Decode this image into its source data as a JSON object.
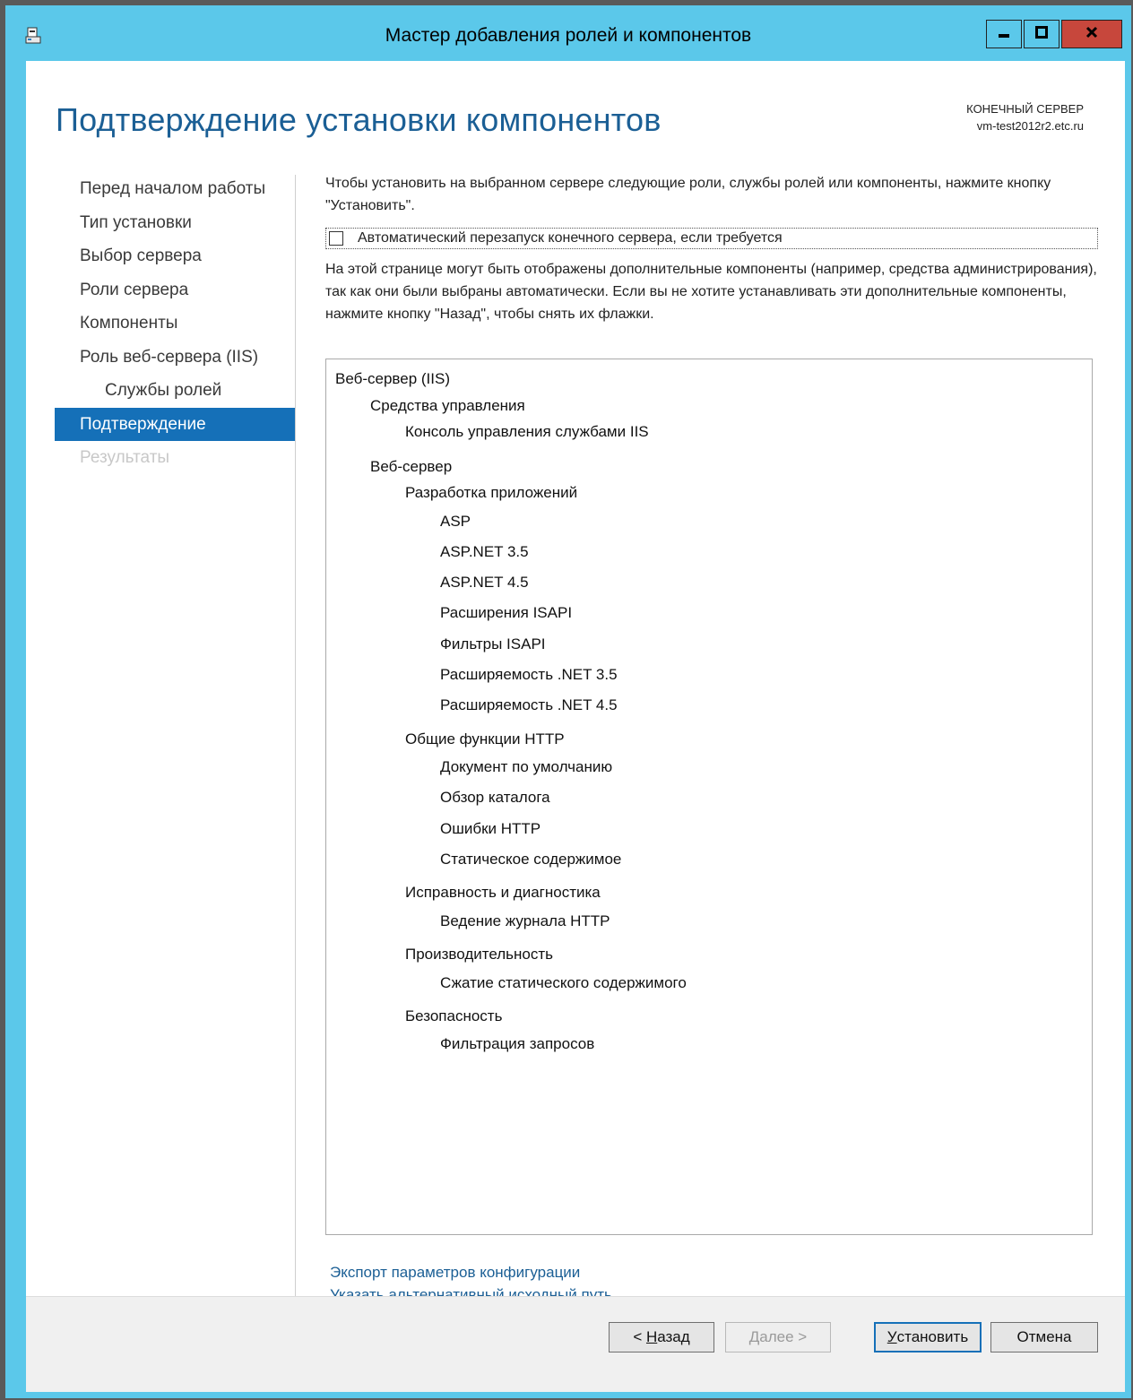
{
  "window": {
    "title": "Мастер добавления ролей и компонентов",
    "accent_color": "#5bc8ea",
    "close_color": "#c7473c",
    "icons": {
      "app": "server-manager-icon",
      "min": "minimize-icon",
      "max": "maximize-icon",
      "close": "close-icon"
    }
  },
  "header": {
    "title": "Подтверждение установки компонентов",
    "dest_label": "КОНЕЧНЫЙ СЕРВЕР",
    "dest_value": "vm-test2012r2.etc.ru"
  },
  "nav": {
    "active_color": "#1570b8",
    "items": [
      {
        "label": "Перед началом работы",
        "state": "normal"
      },
      {
        "label": "Тип установки",
        "state": "normal"
      },
      {
        "label": "Выбор сервера",
        "state": "normal"
      },
      {
        "label": "Роли сервера",
        "state": "normal"
      },
      {
        "label": "Компоненты",
        "state": "normal"
      },
      {
        "label": "Роль веб-сервера (IIS)",
        "state": "normal"
      },
      {
        "label": "Службы ролей",
        "state": "normal",
        "sub": true
      },
      {
        "label": "Подтверждение",
        "state": "active"
      },
      {
        "label": "Результаты",
        "state": "disabled"
      }
    ]
  },
  "content": {
    "intro": "Чтобы установить на выбранном сервере следующие роли, службы ролей или компоненты, нажмите кнопку \"Установить\".",
    "restart_label": "Автоматический перезапуск конечного сервера, если требуется",
    "restart_checked": false,
    "note": "На этой странице могут быть отображены дополнительные компоненты (например, средства администрирования), так как они были выбраны автоматически. Если вы не хотите устанавливать эти дополнительные компоненты, нажмите кнопку \"Назад\", чтобы снять их флажки."
  },
  "components": [
    {
      "text": "Веб-сервер (IIS)",
      "level": 0
    },
    {
      "text": "Средства управления",
      "level": 1
    },
    {
      "text": "Консоль управления службами IIS",
      "level": 2
    },
    {
      "text": "Веб-сервер",
      "level": 1
    },
    {
      "text": "Разработка приложений",
      "level": 2
    },
    {
      "text": "ASP",
      "level": 3
    },
    {
      "text": "ASP.NET 3.5",
      "level": 3
    },
    {
      "text": "ASP.NET 4.5",
      "level": 3
    },
    {
      "text": "Расширения ISAPI",
      "level": 3
    },
    {
      "text": "Фильтры ISAPI",
      "level": 3
    },
    {
      "text": "Расширяемость .NET 3.5",
      "level": 3
    },
    {
      "text": "Расширяемость .NET 4.5",
      "level": 3
    },
    {
      "text": "Общие функции HTTP",
      "level": 2
    },
    {
      "text": "Документ по умолчанию",
      "level": 3
    },
    {
      "text": "Обзор каталога",
      "level": 3
    },
    {
      "text": "Ошибки HTTP",
      "level": 3
    },
    {
      "text": "Статическое содержимое",
      "level": 3
    },
    {
      "text": "Исправность и диагностика",
      "level": 2
    },
    {
      "text": "Ведение журнала HTTP",
      "level": 3
    },
    {
      "text": "Производительность",
      "level": 2
    },
    {
      "text": "Сжатие статического содержимого",
      "level": 3
    },
    {
      "text": "Безопасность",
      "level": 2
    },
    {
      "text": "Фильтрация запросов",
      "level": 3
    }
  ],
  "links": {
    "export": "Экспорт параметров конфигурации",
    "alt_source": "Указать альтернативный исходный путь"
  },
  "buttons": {
    "back_prefix": "< ",
    "back_key": "Н",
    "back_rest": "азад",
    "next_key": "Д",
    "next_rest": "алее >",
    "install_key": "У",
    "install_rest": "становить",
    "cancel": "Отмена"
  }
}
